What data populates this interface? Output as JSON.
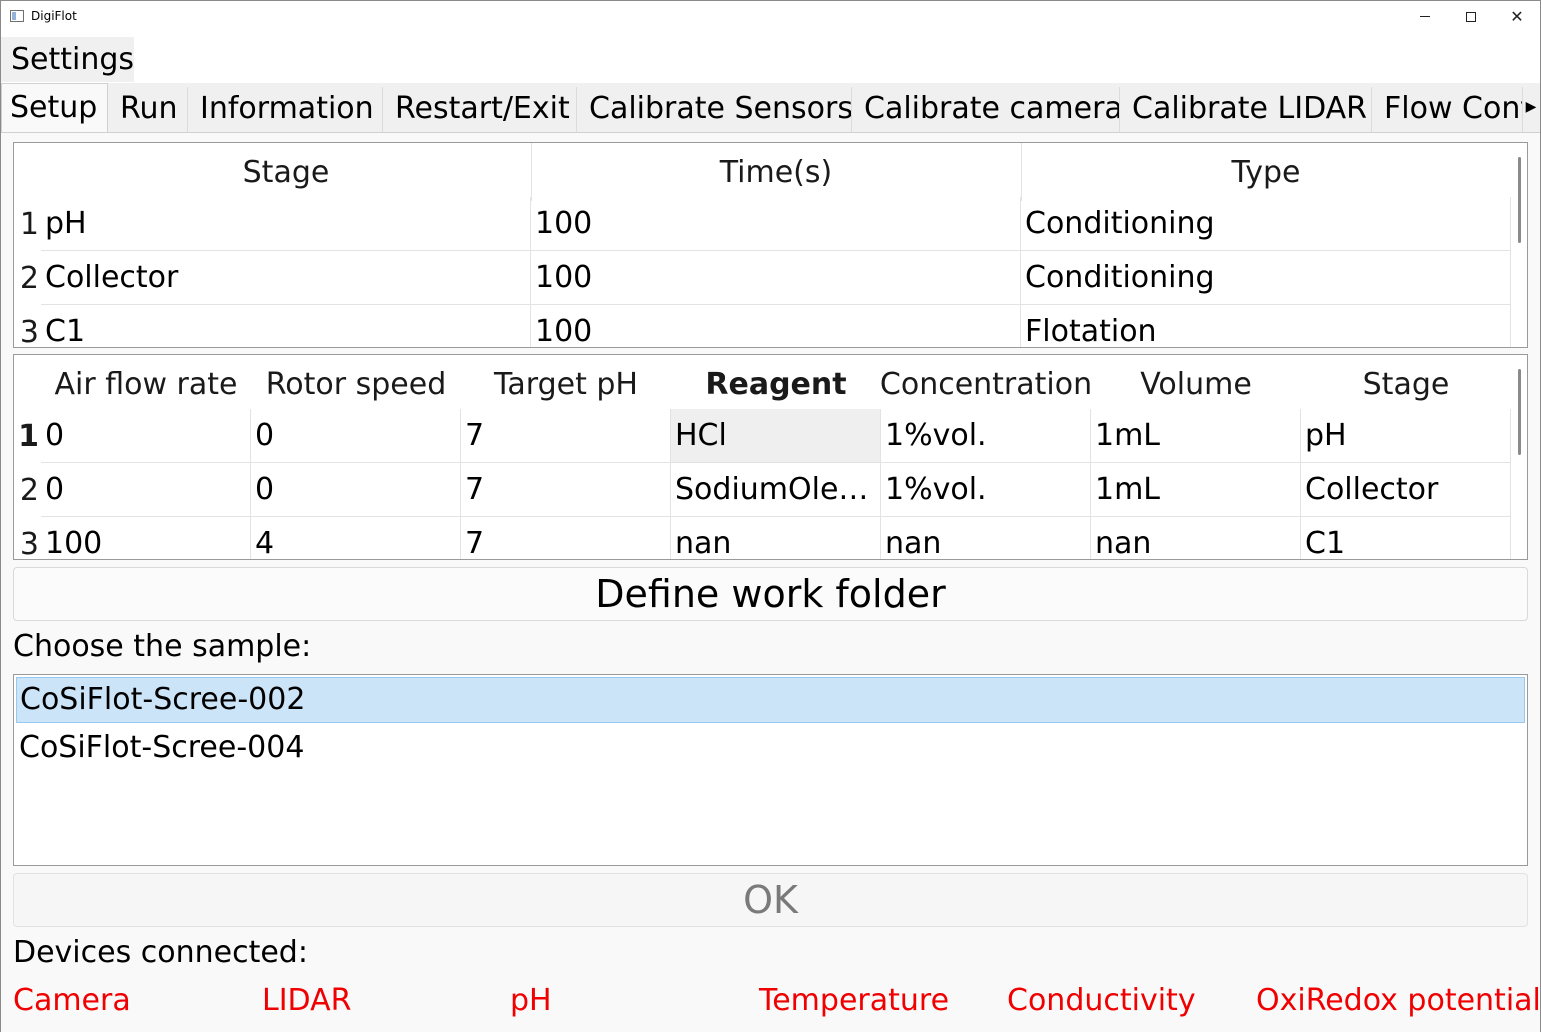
{
  "window": {
    "title": "DigiFlot"
  },
  "menubar": {
    "settings_label": "Settings"
  },
  "tabs": [
    "Setup",
    "Run",
    "Information",
    "Restart/Exit",
    "Calibrate Sensors",
    "Calibrate camera",
    "Calibrate LIDAR",
    "Flow Cont"
  ],
  "stages_table": {
    "headers": [
      "Stage",
      "Time(s)",
      "Type"
    ],
    "row_numbers": [
      "1",
      "2",
      "3"
    ],
    "rows": [
      [
        "pH",
        "100",
        "Conditioning"
      ],
      [
        "Collector",
        "100",
        "Conditioning"
      ],
      [
        "C1",
        "100",
        "Flotation"
      ]
    ]
  },
  "params_table": {
    "headers": [
      "Air flow rate",
      "Rotor speed",
      "Target pH",
      "Reagent",
      "Concentration",
      "Volume",
      "Stage"
    ],
    "row_numbers": [
      "1",
      "2",
      "3"
    ],
    "rows": [
      [
        "0",
        "0",
        "7",
        "HCl",
        "1%vol.",
        "1mL",
        "pH"
      ],
      [
        "0",
        "0",
        "7",
        "SodiumOlea…",
        "1%vol.",
        "1mL",
        "Collector"
      ],
      [
        "100",
        "4",
        "7",
        "nan",
        "nan",
        "nan",
        "C1"
      ]
    ]
  },
  "define_folder_label": "Define work folder",
  "choose_sample_label": "Choose the sample:",
  "samples": [
    "CoSiFlot-Scree-002",
    "CoSiFlot-Scree-004"
  ],
  "ok_label": "OK",
  "devices_label": "Devices connected:",
  "devices": [
    "Camera",
    "LIDAR",
    "pH",
    "Temperature",
    "Conductivity",
    "OxiRedox potential"
  ],
  "colors": {
    "device_disconnected": "#f00000",
    "selection": "#cce4f7"
  }
}
